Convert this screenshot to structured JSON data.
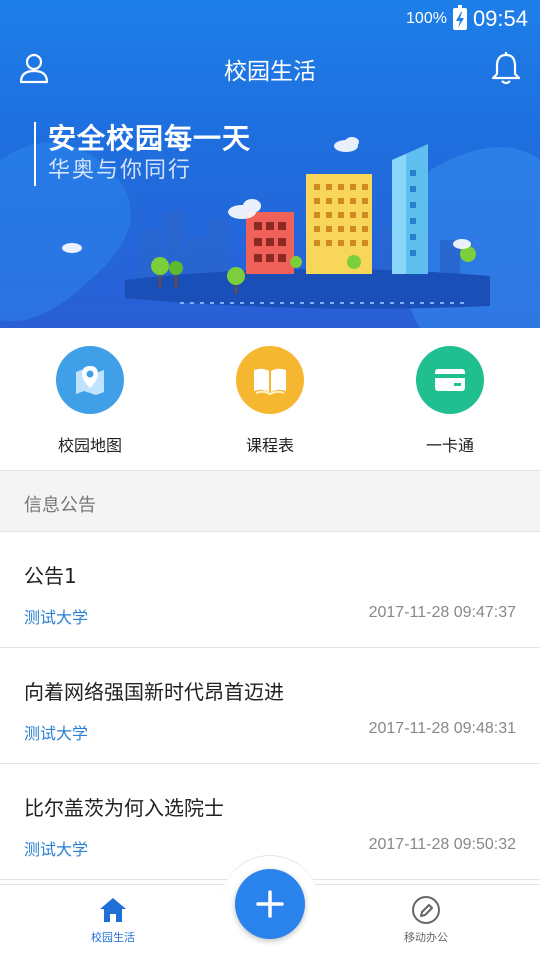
{
  "status_bar": {
    "battery": "100%",
    "time": "09:54"
  },
  "app_bar": {
    "title": "校园生活",
    "profile_icon": "person-icon",
    "notification_icon": "bell-icon"
  },
  "banner": {
    "title": "安全校园每一天",
    "subtitle": "华奥与你同行"
  },
  "shortcuts": [
    {
      "label": "校园地图",
      "icon": "map-pin-icon",
      "color": "#3fa0e8"
    },
    {
      "label": "课程表",
      "icon": "book-icon",
      "color": "#f5b730"
    },
    {
      "label": "一卡通",
      "icon": "card-icon",
      "color": "#1fbf8f"
    }
  ],
  "section": {
    "title": "信息公告"
  },
  "news": [
    {
      "title": "公告1",
      "source": "测试大学",
      "time": "2017-11-28 09:47:37"
    },
    {
      "title": "向着网络强国新时代昂首迈进",
      "source": "测试大学",
      "time": "2017-11-28 09:48:31"
    },
    {
      "title": "比尔盖茨为何入选院士",
      "source": "测试大学",
      "time": "2017-11-28 09:50:32"
    }
  ],
  "bottom_nav": {
    "home_label": "校园生活",
    "office_label": "移动办公",
    "add_icon": "plus-icon",
    "active_color": "#1e6fd6",
    "inactive_color": "#666666"
  }
}
